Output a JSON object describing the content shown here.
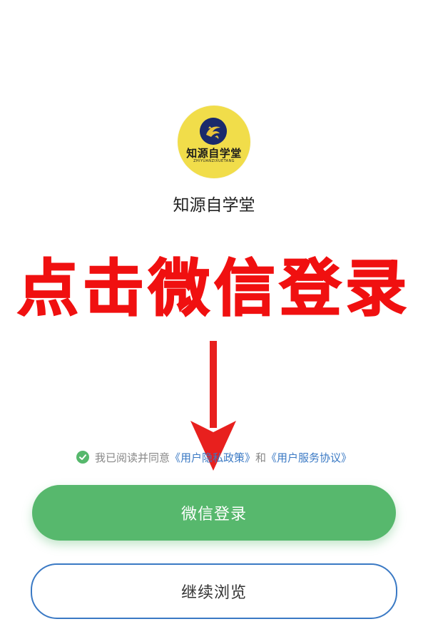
{
  "brand": {
    "logo_name_cn": "知源自学堂",
    "logo_name_en": "ZHIYUANZIXUETANG",
    "app_name": "知源自学堂",
    "logo_bg_color": "#f1dd4a",
    "emblem_color": "#1a2a6c"
  },
  "annotation": {
    "banner_text": "点击微信登录",
    "color": "#f01010",
    "arrow_icon": "arrow-down-icon"
  },
  "agreement": {
    "checked": true,
    "check_icon": "check-circle-icon",
    "prefix": "我已阅读并同意",
    "privacy_link": "《用户隐私政策》",
    "conjunction": "和",
    "service_link": "《用户服务协议》",
    "link_color": "#3a79c4"
  },
  "actions": {
    "wechat_login_label": "微信登录",
    "continue_browse_label": "继续浏览",
    "primary_color": "#57b86d",
    "secondary_border_color": "#3a79c4"
  }
}
